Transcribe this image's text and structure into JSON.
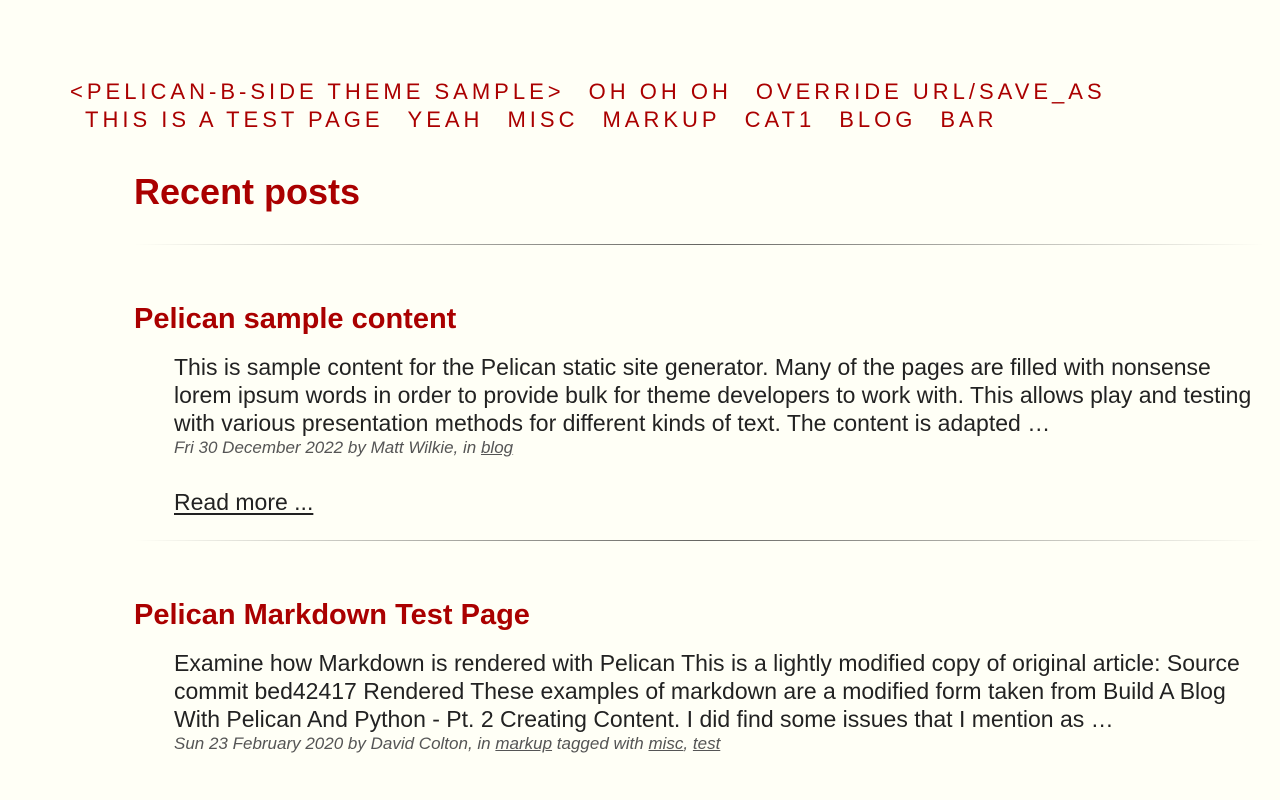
{
  "nav": {
    "row1": [
      "<pelican-b-side theme sample>",
      "Oh Oh Oh",
      "Override url/save_as"
    ],
    "row2": [
      "This is a test page",
      "Yeah",
      "misc",
      "markup",
      "cat1",
      "blog",
      "bar"
    ]
  },
  "main": {
    "title": "Recent posts",
    "articles": [
      {
        "title": "Pelican sample content",
        "summary": "This is sample content for the Pelican static site generator. Many of the pages are filled with nonsense lorem ipsum words in order to provide bulk for theme developers to work with. This allows play and testing with various presentation methods for different kinds of text. The content is adapted …",
        "date": "Fri 30 December 2022",
        "by": "by",
        "author": "Matt Wilkie",
        "in": ", in",
        "category": "blog",
        "read_more": "Read more ..."
      },
      {
        "title": "Pelican Markdown Test Page",
        "summary": "Examine how Markdown is rendered with Pelican This is a lightly modified copy of original article: Source commit bed42417 Rendered These examples of markdown are a modified form taken from Build A Blog With Pelican And Python - Pt. 2 Creating Content. I did find some issues that I mention as …",
        "date": "Sun 23 February 2020",
        "by": "by",
        "author": "David Colton",
        "in": ", in",
        "category": "markup",
        "tagged": "tagged with",
        "tags": [
          "misc",
          "test"
        ],
        "tag_sep": ","
      }
    ]
  },
  "colors": {
    "accent": "#aa0000",
    "background": "#fffff6",
    "text": "#222222",
    "meta": "#555555"
  }
}
